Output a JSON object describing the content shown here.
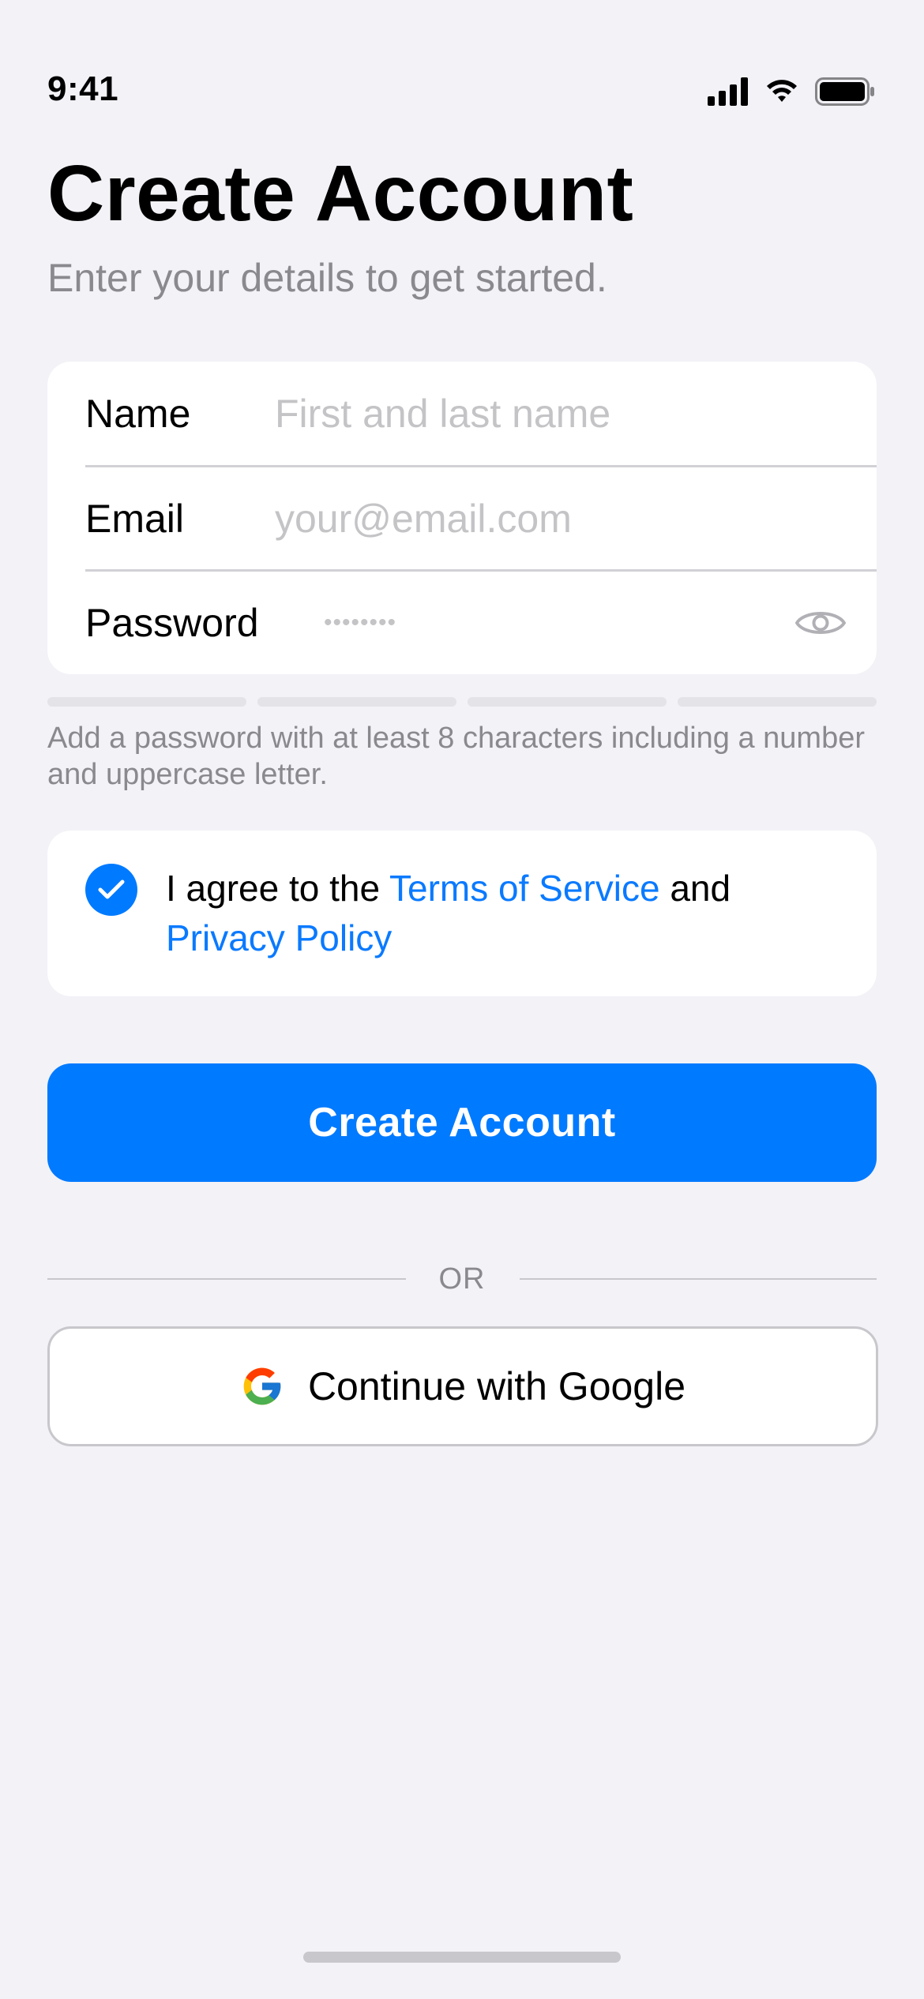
{
  "status_bar": {
    "time": "9:41"
  },
  "header": {
    "title": "Create Account",
    "subtitle": "Enter your details to get started."
  },
  "form": {
    "name": {
      "label": "Name",
      "placeholder": "First and last name",
      "value": ""
    },
    "email": {
      "label": "Email",
      "placeholder": "your@email.com",
      "value": ""
    },
    "password": {
      "label": "Password",
      "masked_placeholder": "••••••••",
      "value": ""
    }
  },
  "password_strength": {
    "segments": 4,
    "filled": 0
  },
  "password_hint": "Add a password with at least 8 characters including a number and uppercase letter.",
  "terms": {
    "checked": true,
    "prefix": "I agree to the ",
    "terms_link": "Terms of Service",
    "middle": " and ",
    "privacy_link": "Privacy Policy"
  },
  "actions": {
    "create_account_label": "Create Account",
    "or_label": "OR",
    "google_label": "Continue with Google"
  },
  "colors": {
    "accent": "#007aff",
    "link": "#0a7aff",
    "background": "#f2f2f7",
    "secondary_text": "#8a8a8e"
  },
  "icons": {
    "signal": "cellular-signal-icon",
    "wifi": "wifi-icon",
    "battery": "battery-icon",
    "eye": "eye-icon",
    "check": "checkmark-icon",
    "google": "google-logo-icon"
  }
}
